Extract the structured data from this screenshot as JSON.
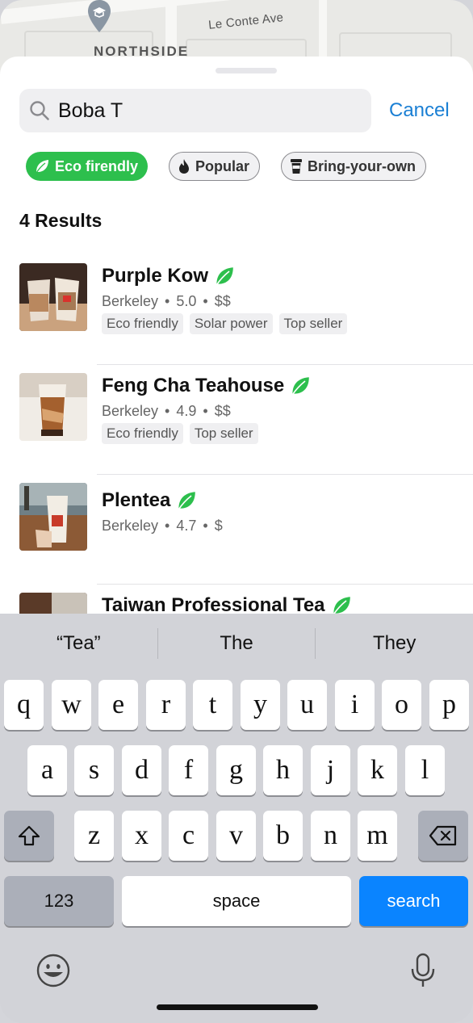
{
  "map": {
    "street_label": "Le Conte Ave",
    "area_label": "NORTHSIDE"
  },
  "search": {
    "query": "Boba T",
    "cancel_label": "Cancel"
  },
  "filters": [
    {
      "label": "Eco firendly",
      "icon": "leaf-icon",
      "active": true
    },
    {
      "label": "Popular",
      "icon": "flame-icon",
      "active": false
    },
    {
      "label": "Bring-your-own",
      "icon": "cup-icon",
      "active": false
    }
  ],
  "results_count": "4 Results",
  "results": [
    {
      "name": "Purple Kow",
      "location": "Berkeley",
      "rating": "5.0",
      "price": "$$",
      "eco": true,
      "tags": [
        "Eco friendly",
        "Solar power",
        "Top seller"
      ]
    },
    {
      "name": "Feng Cha Teahouse",
      "location": "Berkeley",
      "rating": "4.9",
      "price": "$$",
      "eco": true,
      "tags": [
        "Eco friendly",
        "Top seller"
      ]
    },
    {
      "name": "Plentea",
      "location": "Berkeley",
      "rating": "4.7",
      "price": "$",
      "eco": true,
      "tags": []
    },
    {
      "name": "Taiwan Professional Tea",
      "location": "",
      "rating": "",
      "price": "",
      "eco": true,
      "tags": []
    }
  ],
  "keyboard": {
    "suggestions": [
      "“Tea”",
      "The",
      "They"
    ],
    "row1": [
      "q",
      "w",
      "e",
      "r",
      "t",
      "y",
      "u",
      "i",
      "o",
      "p"
    ],
    "row2": [
      "a",
      "s",
      "d",
      "f",
      "g",
      "h",
      "j",
      "k",
      "l"
    ],
    "row3": [
      "z",
      "x",
      "c",
      "v",
      "b",
      "n",
      "m"
    ],
    "numbers_label": "123",
    "space_label": "space",
    "search_label": "search"
  },
  "colors": {
    "accent_green": "#2dbf4d",
    "link_blue": "#1a7fd4",
    "key_blue": "#0a84ff"
  }
}
